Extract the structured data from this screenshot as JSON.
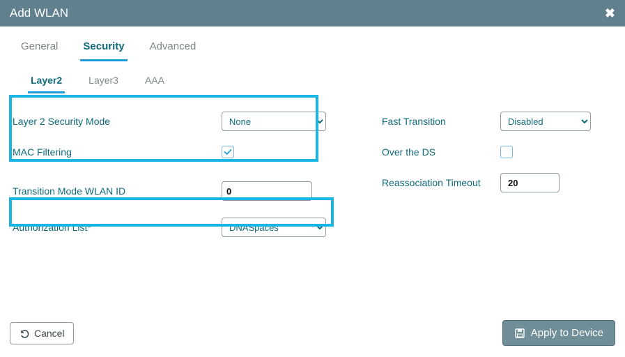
{
  "titlebar": {
    "title": "Add WLAN"
  },
  "tabs": {
    "primary": [
      "General",
      "Security",
      "Advanced"
    ],
    "active_primary": "Security",
    "sub": [
      "Layer2",
      "Layer3",
      "AAA"
    ],
    "active_sub": "Layer2"
  },
  "form": {
    "security_mode_label": "Layer 2 Security Mode",
    "security_mode_value": "None",
    "mac_filtering_label": "MAC Filtering",
    "mac_filtering_checked": true,
    "transition_mode_label": "Transition Mode WLAN ID",
    "transition_mode_value": "0",
    "auth_list_label": "Authorization List*",
    "auth_list_value": "DNASpaces",
    "fast_transition_label": "Fast Transition",
    "fast_transition_value": "Disabled",
    "over_ds_label": "Over the DS",
    "over_ds_checked": false,
    "reassoc_label": "Reassociation Timeout",
    "reassoc_value": "20"
  },
  "footer": {
    "cancel": "Cancel",
    "apply": "Apply to Device"
  }
}
